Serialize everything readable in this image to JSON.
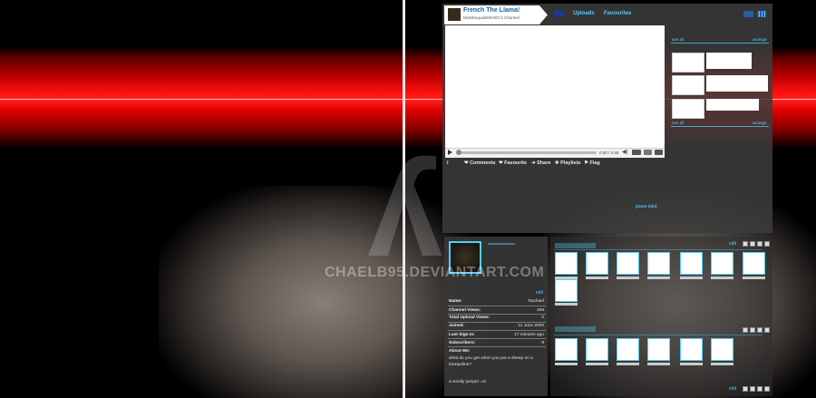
{
  "watermark": "CHAELB95.DEVIANTART.COM",
  "channel": {
    "title": "French The Llama!",
    "subtitle": "MUSEequalsMUSIC's Channel"
  },
  "nav": {
    "uploads": "Uploads",
    "favourites": "Favourites"
  },
  "player": {
    "time": "0:00 / 3:45"
  },
  "actions": {
    "comments": "Comments",
    "favourite": "Favourite",
    "share": "Share",
    "playlists": "Playlists",
    "flag": "Flag"
  },
  "more_info": "(more info)",
  "sidebar": {
    "see_all_1": "see all",
    "arrange_1": "arrange",
    "see_all_2": "see all",
    "arrange_2": "arrange"
  },
  "profile": {
    "edit": "edit",
    "rows": [
      {
        "label": "Name:",
        "value": "Rachael"
      },
      {
        "label": "Channel Views:",
        "value": "459"
      },
      {
        "label": "Total Upload Views:",
        "value": "0"
      },
      {
        "label": "Joined:",
        "value": "11 June 2009"
      },
      {
        "label": "Last Sign In:",
        "value": "17 minutes ago"
      },
      {
        "label": "Subscribers:",
        "value": "9"
      }
    ],
    "about_label": "About Me:",
    "about_text": "what do you get when you put a sheep on a trampoline?",
    "about_text2": "a woolly jumper =D"
  },
  "videos": {
    "edit_top": "edit",
    "edit_bottom": "edit"
  },
  "colors": {
    "accent": "#4fd0ff",
    "red_band": "#ff1010"
  }
}
